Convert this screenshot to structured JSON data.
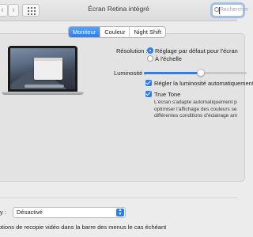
{
  "window": {
    "title": "Écran Retina intégré"
  },
  "toolbar": {
    "prev_glyph": "‹",
    "next_glyph": "›",
    "search_placeholder": "Rechercher"
  },
  "tabs": [
    {
      "label": "Moniteur",
      "active": true
    },
    {
      "label": "Couleur",
      "active": false
    },
    {
      "label": "Night Shift",
      "active": false
    }
  ],
  "display": {
    "resolution_label": "Résolution :",
    "resolution_options": [
      {
        "label": "Réglage par défaut pour l'écran",
        "selected": true
      },
      {
        "label": "À l'échelle",
        "selected": false
      }
    ],
    "brightness_label": "Luminosité :",
    "brightness_level": 0.55,
    "auto_brightness_label": "Régler la luminosité automatiquement",
    "auto_brightness_checked": true,
    "true_tone_label": "True Tone",
    "true_tone_checked": true,
    "true_tone_description": [
      "L'écran s'adapte automatiquement p",
      "optimiser l'affichage des couleurs se",
      "différentes conditions d'éclairage am"
    ]
  },
  "airplay": {
    "label": "y :",
    "value": "Désactivé"
  },
  "mirroring_label": "ptions de recopie vidéo dans la barre des menus le cas échéant",
  "colors": {
    "accent": "#2c7df0",
    "background": "#ececec"
  }
}
